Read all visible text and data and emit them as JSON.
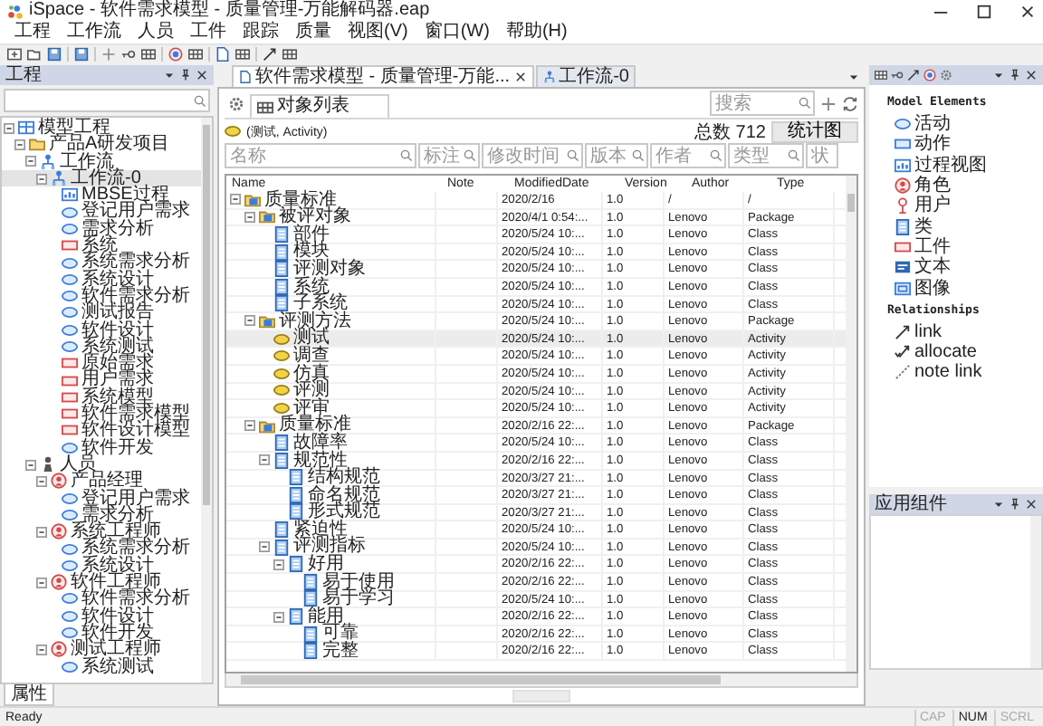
{
  "window": {
    "title": "iSpace - 软件需求模型 - 质量管理-万能解码器.eap"
  },
  "menu": [
    "工程",
    "工作流",
    "人员",
    "工件",
    "跟踪",
    "质量",
    "视图(V)",
    "窗口(W)",
    "帮助(H)"
  ],
  "project_panel": {
    "title": "工程",
    "tree": [
      {
        "label": "模型工程",
        "kind": "project",
        "expanded": true,
        "selected": false,
        "children": [
          {
            "label": "产品A研发项目",
            "kind": "folder",
            "expanded": true,
            "selected": false,
            "children": [
              {
                "label": "工作流",
                "kind": "workflow",
                "expanded": true,
                "selected": false,
                "children": [
                  {
                    "label": "工作流-0",
                    "kind": "workflow",
                    "expanded": true,
                    "selected": true,
                    "children": [
                      {
                        "label": "MBSE过程",
                        "kind": "diagram",
                        "selected": false
                      },
                      {
                        "label": "登记用户需求",
                        "kind": "activity",
                        "selected": false
                      },
                      {
                        "label": "需求分析",
                        "kind": "activity",
                        "selected": false
                      },
                      {
                        "label": "系统",
                        "kind": "artifact",
                        "selected": false
                      },
                      {
                        "label": "系统需求分析",
                        "kind": "activity",
                        "selected": false
                      },
                      {
                        "label": "系统设计",
                        "kind": "activity",
                        "selected": false
                      },
                      {
                        "label": "软件需求分析",
                        "kind": "activity",
                        "selected": false
                      },
                      {
                        "label": "测试报告",
                        "kind": "activity",
                        "selected": false
                      },
                      {
                        "label": "软件设计",
                        "kind": "activity",
                        "selected": false
                      },
                      {
                        "label": "系统测试",
                        "kind": "activity",
                        "selected": false
                      },
                      {
                        "label": "原始需求",
                        "kind": "artifact",
                        "selected": false
                      },
                      {
                        "label": "用户需求",
                        "kind": "artifact",
                        "selected": false
                      },
                      {
                        "label": "系统模型",
                        "kind": "artifact",
                        "selected": false
                      },
                      {
                        "label": "软件需求模型",
                        "kind": "artifact",
                        "selected": false
                      },
                      {
                        "label": "软件设计模型",
                        "kind": "artifact",
                        "selected": false
                      },
                      {
                        "label": "软件开发",
                        "kind": "activity",
                        "selected": false
                      }
                    ]
                  }
                ]
              },
              {
                "label": "人员",
                "kind": "people",
                "expanded": true,
                "selected": false,
                "children": [
                  {
                    "label": "产品经理",
                    "kind": "role",
                    "expanded": true,
                    "selected": false,
                    "children": [
                      {
                        "label": "登记用户需求",
                        "kind": "activity",
                        "selected": false
                      },
                      {
                        "label": "需求分析",
                        "kind": "activity",
                        "selected": false
                      }
                    ]
                  },
                  {
                    "label": "系统工程师",
                    "kind": "role",
                    "expanded": true,
                    "selected": false,
                    "children": [
                      {
                        "label": "系统需求分析",
                        "kind": "activity",
                        "selected": false
                      },
                      {
                        "label": "系统设计",
                        "kind": "activity",
                        "selected": false
                      }
                    ]
                  },
                  {
                    "label": "软件工程师",
                    "kind": "role",
                    "expanded": true,
                    "selected": false,
                    "children": [
                      {
                        "label": "软件需求分析",
                        "kind": "activity",
                        "selected": false
                      },
                      {
                        "label": "软件设计",
                        "kind": "activity",
                        "selected": false
                      },
                      {
                        "label": "软件开发",
                        "kind": "activity",
                        "selected": false
                      }
                    ]
                  },
                  {
                    "label": "测试工程师",
                    "kind": "role",
                    "expanded": true,
                    "selected": false,
                    "children": [
                      {
                        "label": "系统测试",
                        "kind": "activity",
                        "selected": false
                      }
                    ]
                  }
                ]
              }
            ]
          }
        ]
      }
    ]
  },
  "bottom_tabs": [
    {
      "label": "属性",
      "selected": true
    }
  ],
  "document_tabs": [
    {
      "label": "软件需求模型 - 质量管理-万能...",
      "kind": "document",
      "selected": true,
      "closable": true
    },
    {
      "label": "工作流-0",
      "kind": "workflow",
      "selected": false,
      "closable": false
    }
  ],
  "object_list": {
    "tab": "对象列表",
    "search": {
      "placeholder": "搜索"
    },
    "filter_label": "(测试, Activity)",
    "total": "总数 712",
    "chart_button": "统计图",
    "filters": [
      {
        "placeholder": "名称"
      },
      {
        "placeholder": "标注"
      },
      {
        "placeholder": "修改时间"
      },
      {
        "placeholder": "版本"
      },
      {
        "placeholder": "作者"
      },
      {
        "placeholder": "类型"
      },
      {
        "placeholder": "状"
      }
    ],
    "columns": [
      "Name",
      "Note",
      "ModifiedDate",
      "Version",
      "Author",
      "Type"
    ],
    "rows": [
      {
        "name": "质量标准",
        "kind": "package",
        "date": "2020/2/16",
        "version": "1.0",
        "author": "/",
        "type": "/",
        "expanded": true,
        "selected": false,
        "children": [
          {
            "name": "被评对象",
            "kind": "package",
            "date": "2020/4/1 0:54:...",
            "version": "1.0",
            "author": "Lenovo",
            "type": "Package",
            "expanded": true,
            "selected": false,
            "children": [
              {
                "name": "部件",
                "kind": "class",
                "date": "2020/5/24 10:...",
                "version": "1.0",
                "author": "Lenovo",
                "type": "Class",
                "selected": false
              },
              {
                "name": "模块",
                "kind": "class",
                "date": "2020/5/24 10:...",
                "version": "1.0",
                "author": "Lenovo",
                "type": "Class",
                "selected": false
              },
              {
                "name": "评测对象",
                "kind": "class",
                "date": "2020/5/24 10:...",
                "version": "1.0",
                "author": "Lenovo",
                "type": "Class",
                "selected": false
              },
              {
                "name": "系统",
                "kind": "class",
                "date": "2020/5/24 10:...",
                "version": "1.0",
                "author": "Lenovo",
                "type": "Class",
                "selected": false
              },
              {
                "name": "子系统",
                "kind": "class",
                "date": "2020/5/24 10:...",
                "version": "1.0",
                "author": "Lenovo",
                "type": "Class",
                "selected": false
              }
            ]
          },
          {
            "name": "评测方法",
            "kind": "package",
            "date": "2020/5/24 10:...",
            "version": "1.0",
            "author": "Lenovo",
            "type": "Package",
            "expanded": true,
            "selected": false,
            "children": [
              {
                "name": "测试",
                "kind": "activity",
                "date": "2020/5/24 10:...",
                "version": "1.0",
                "author": "Lenovo",
                "type": "Activity",
                "selected": true
              },
              {
                "name": "调查",
                "kind": "activity",
                "date": "2020/5/24 10:...",
                "version": "1.0",
                "author": "Lenovo",
                "type": "Activity",
                "selected": false
              },
              {
                "name": "仿真",
                "kind": "activity",
                "date": "2020/5/24 10:...",
                "version": "1.0",
                "author": "Lenovo",
                "type": "Activity",
                "selected": false
              },
              {
                "name": "评测",
                "kind": "activity",
                "date": "2020/5/24 10:...",
                "version": "1.0",
                "author": "Lenovo",
                "type": "Activity",
                "selected": false
              },
              {
                "name": "评审",
                "kind": "activity",
                "date": "2020/5/24 10:...",
                "version": "1.0",
                "author": "Lenovo",
                "type": "Activity",
                "selected": false
              }
            ]
          },
          {
            "name": "质量标准",
            "kind": "package",
            "date": "2020/2/16 22:...",
            "version": "1.0",
            "author": "Lenovo",
            "type": "Package",
            "expanded": true,
            "selected": false,
            "children": [
              {
                "name": "故障率",
                "kind": "class",
                "date": "2020/5/24 10:...",
                "version": "1.0",
                "author": "Lenovo",
                "type": "Class",
                "selected": false
              },
              {
                "name": "规范性",
                "kind": "class",
                "date": "2020/2/16 22:...",
                "version": "1.0",
                "author": "Lenovo",
                "type": "Class",
                "expanded": true,
                "selected": false,
                "children": [
                  {
                    "name": "结构规范",
                    "kind": "class",
                    "date": "2020/3/27 21:...",
                    "version": "1.0",
                    "author": "Lenovo",
                    "type": "Class",
                    "selected": false
                  },
                  {
                    "name": "命名规范",
                    "kind": "class",
                    "date": "2020/3/27 21:...",
                    "version": "1.0",
                    "author": "Lenovo",
                    "type": "Class",
                    "selected": false
                  },
                  {
                    "name": "形式规范",
                    "kind": "class",
                    "date": "2020/3/27 21:...",
                    "version": "1.0",
                    "author": "Lenovo",
                    "type": "Class",
                    "selected": false
                  }
                ]
              },
              {
                "name": "紧迫性",
                "kind": "class",
                "date": "2020/5/24 10:...",
                "version": "1.0",
                "author": "Lenovo",
                "type": "Class",
                "selected": false
              },
              {
                "name": "评测指标",
                "kind": "class",
                "date": "2020/5/24 10:...",
                "version": "1.0",
                "author": "Lenovo",
                "type": "Class",
                "expanded": true,
                "selected": false,
                "children": [
                  {
                    "name": "好用",
                    "kind": "class",
                    "date": "2020/2/16 22:...",
                    "version": "1.0",
                    "author": "Lenovo",
                    "type": "Class",
                    "expanded": true,
                    "selected": false,
                    "children": [
                      {
                        "name": "易于使用",
                        "kind": "class",
                        "date": "2020/2/16 22:...",
                        "version": "1.0",
                        "author": "Lenovo",
                        "type": "Class",
                        "selected": false
                      },
                      {
                        "name": "易于学习",
                        "kind": "class",
                        "date": "2020/5/24 10:...",
                        "version": "1.0",
                        "author": "Lenovo",
                        "type": "Class",
                        "selected": false
                      }
                    ]
                  },
                  {
                    "name": "能用",
                    "kind": "class",
                    "date": "2020/2/16 22:...",
                    "version": "1.0",
                    "author": "Lenovo",
                    "type": "Class",
                    "expanded": true,
                    "selected": false,
                    "children": [
                      {
                        "name": "可靠",
                        "kind": "class",
                        "date": "2020/2/16 22:...",
                        "version": "1.0",
                        "author": "Lenovo",
                        "type": "Class",
                        "selected": false
                      },
                      {
                        "name": "完整",
                        "kind": "class",
                        "date": "2020/2/16 22:...",
                        "version": "1.0",
                        "author": "Lenovo",
                        "type": "Class",
                        "selected": false
                      }
                    ]
                  }
                ]
              }
            ]
          }
        ]
      }
    ]
  },
  "toolbox": {
    "sections": [
      {
        "title": "Model Elements",
        "items": [
          {
            "label": "活动",
            "kind": "activity"
          },
          {
            "label": "动作",
            "kind": "action"
          },
          {
            "label": "过程视图",
            "kind": "diagram"
          },
          {
            "label": "角色",
            "kind": "role"
          },
          {
            "label": "用户",
            "kind": "user"
          },
          {
            "label": "类",
            "kind": "class"
          },
          {
            "label": "工件",
            "kind": "artifact"
          },
          {
            "label": "文本",
            "kind": "text"
          },
          {
            "label": "图像",
            "kind": "image"
          }
        ]
      },
      {
        "title": "Relationships",
        "items": [
          {
            "label": "link",
            "kind": "link"
          },
          {
            "label": "allocate",
            "kind": "allocate"
          },
          {
            "label": "note link",
            "kind": "note_link"
          }
        ]
      }
    ]
  },
  "components_panel": {
    "title": "应用组件"
  },
  "status_bar": {
    "text": "Ready",
    "indicators": [
      {
        "label": "CAP",
        "on": false
      },
      {
        "label": "NUM",
        "on": true
      },
      {
        "label": "SCRL",
        "on": false
      }
    ]
  }
}
